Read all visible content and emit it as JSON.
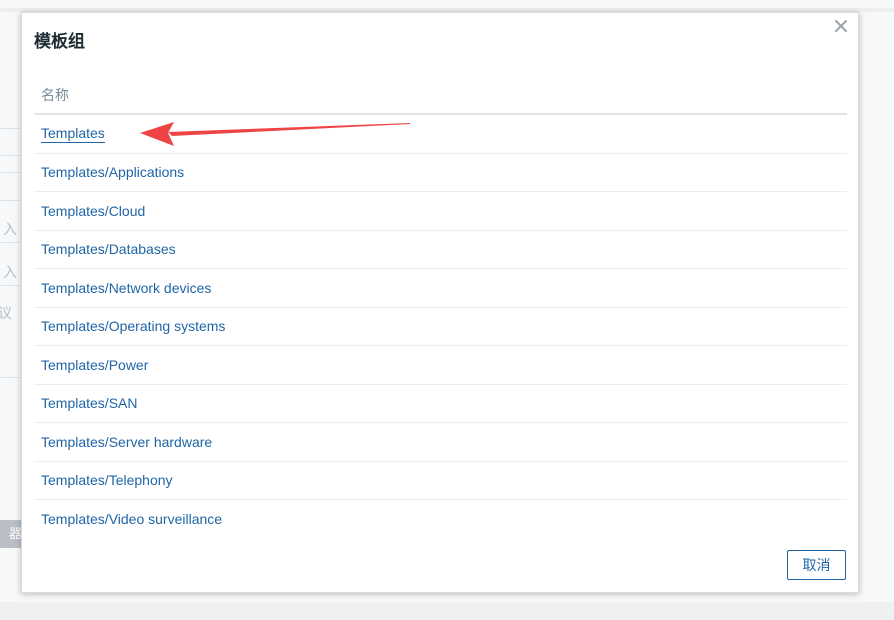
{
  "background": {
    "fragments": [
      "入",
      "入",
      "议",
      "器"
    ]
  },
  "modal": {
    "title": "模板组",
    "close_icon": "close-icon",
    "column_header": "名称",
    "groups": [
      "Templates",
      "Templates/Applications",
      "Templates/Cloud",
      "Templates/Databases",
      "Templates/Network devices",
      "Templates/Operating systems",
      "Templates/Power",
      "Templates/SAN",
      "Templates/Server hardware",
      "Templates/Telephony",
      "Templates/Video surveillance"
    ],
    "cancel_label": "取消"
  },
  "annotation": {
    "arrow_color": "#ef4444"
  },
  "colors": {
    "link": "#1f65a6",
    "header_text": "#768d99",
    "title_text": "#1f2c33"
  }
}
